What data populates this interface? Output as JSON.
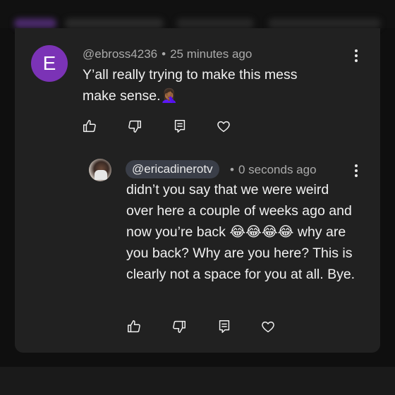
{
  "comment": {
    "avatar_letter": "E",
    "author": "@ebross4236",
    "separator": "•",
    "time": "25 minutes ago",
    "text": "Y’all really trying to make this mess make sense.🤦🏾‍♀️",
    "avatar_color": "#7b33b6"
  },
  "reply": {
    "author": "@ericadinerotv",
    "separator": "•",
    "time": "0 seconds ago",
    "text": "didn’t you say that we were weird over here a couple of weeks ago and now you’re back 😂😂😂😂 why are you back? Why are you here? This is clearly not a space for you at all. Bye."
  },
  "actions": {
    "like_icon": "thumbs-up-icon",
    "dislike_icon": "thumbs-down-icon",
    "reply_icon": "comment-reply-icon",
    "heart_icon": "heart-icon",
    "menu_icon": "kebab-menu-icon"
  },
  "colors": {
    "background": "#0f0f0f",
    "card": "#212121",
    "meta_text": "#aaaaaa",
    "handle_pill": "#3a3e48"
  }
}
